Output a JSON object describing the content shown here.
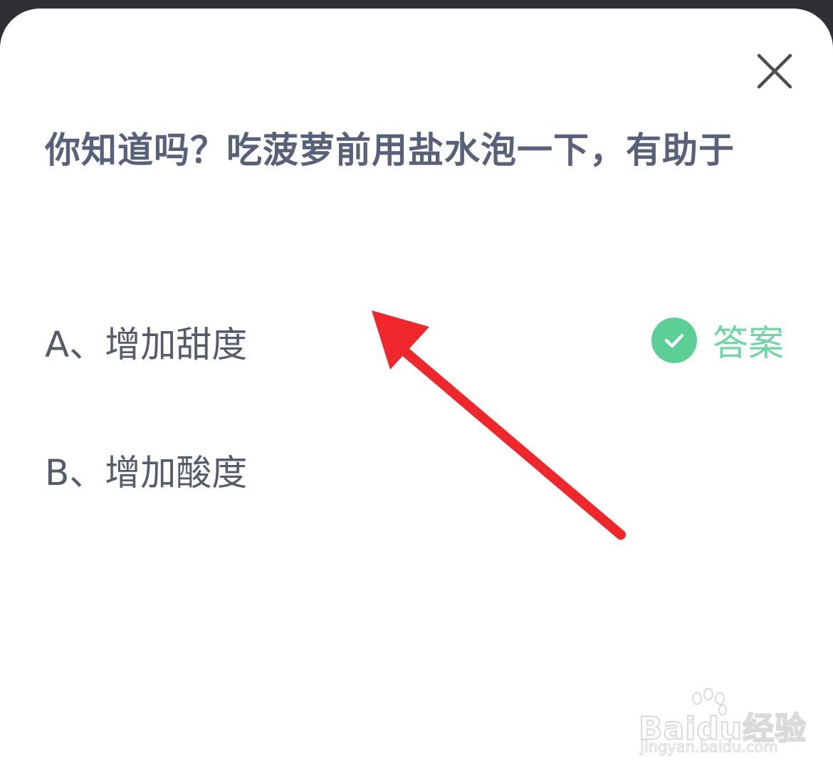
{
  "question": {
    "text": "你知道吗？吃菠萝前用盐水泡一下，有助于"
  },
  "options": [
    {
      "label": "A、增加甜度"
    },
    {
      "label": "B、增加酸度"
    }
  ],
  "answer_badge": {
    "label": "答案",
    "icon": "check-circle-icon",
    "color": "#5ccf96"
  },
  "close_icon": "close-icon",
  "annotation_arrow": {
    "color": "#f0272a"
  },
  "watermark": {
    "brand": "Baidu经验",
    "url": "jingyan.baidu.com"
  }
}
